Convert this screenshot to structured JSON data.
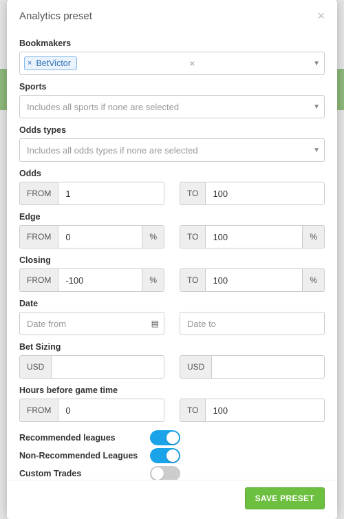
{
  "modal": {
    "title": "Analytics preset",
    "save_label": "SAVE PRESET"
  },
  "bookmakers": {
    "label": "Bookmakers",
    "tags": [
      "BetVictor"
    ]
  },
  "sports": {
    "label": "Sports",
    "placeholder": "Includes all sports if none are selected"
  },
  "odds_types": {
    "label": "Odds types",
    "placeholder": "Includes all odds types if none are selected"
  },
  "odds": {
    "label": "Odds",
    "from_label": "FROM",
    "from_value": "1",
    "to_label": "TO",
    "to_value": "100"
  },
  "edge": {
    "label": "Edge",
    "from_label": "FROM",
    "from_value": "0",
    "from_suffix": "%",
    "to_label": "TO",
    "to_value": "100",
    "to_suffix": "%"
  },
  "closing": {
    "label": "Closing",
    "from_label": "FROM",
    "from_value": "-100",
    "from_suffix": "%",
    "to_label": "TO",
    "to_value": "100",
    "to_suffix": "%"
  },
  "date": {
    "label": "Date",
    "from_placeholder": "Date from",
    "to_placeholder": "Date to"
  },
  "bet_sizing": {
    "label": "Bet Sizing",
    "currency": "USD"
  },
  "hours": {
    "label": "Hours before game time",
    "from_label": "FROM",
    "from_value": "0",
    "to_label": "TO",
    "to_value": "100"
  },
  "toggles": {
    "recommended": {
      "label": "Recommended leagues",
      "on": true
    },
    "non_recommended": {
      "label": "Non-Recommended Leagues",
      "on": true
    },
    "custom_trades": {
      "label": "Custom Trades",
      "on": false
    }
  }
}
